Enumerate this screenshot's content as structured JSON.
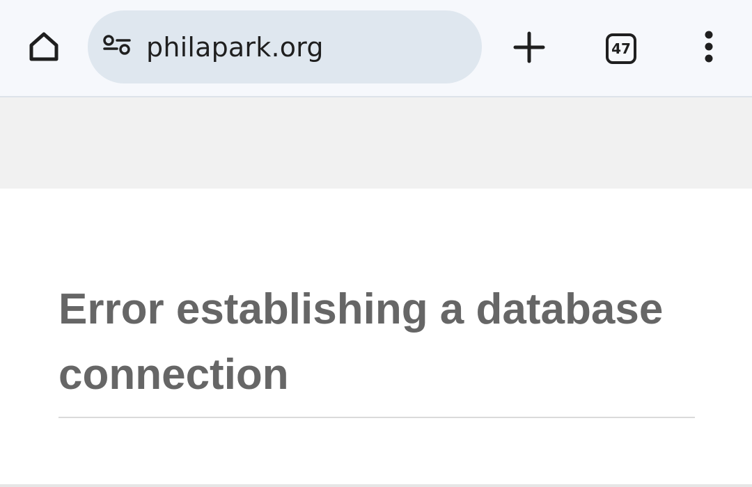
{
  "browser": {
    "url": "philapark.org",
    "tab_count": "47",
    "icons": {
      "home": "home-icon",
      "site_settings": "tune-icon",
      "new_tab": "plus-icon",
      "tab_switcher": "tab-switcher-icon",
      "menu": "more-vert-icon"
    },
    "colors": {
      "toolbar_bg": "#f6f8fc",
      "omnibox_bg": "#dfe7ef",
      "icon": "#1f1f1f"
    }
  },
  "page": {
    "error_title": "Error establishing a database connection",
    "colors": {
      "banner_bg": "#f1f1f1",
      "title_text": "#666666",
      "divider": "#dadada"
    }
  }
}
